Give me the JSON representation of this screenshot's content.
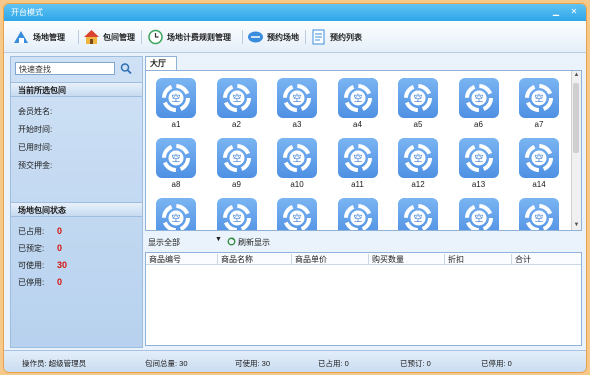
{
  "window": {
    "title": "开台模式"
  },
  "toolbar": {
    "items": [
      {
        "label": "场地管理"
      },
      {
        "label": "包间管理"
      },
      {
        "label": "场地计费规则管理"
      },
      {
        "label": "预约场地"
      },
      {
        "label": "预约列表"
      }
    ]
  },
  "sidebar": {
    "search_value": "快速查找",
    "current_title": "当前所选包间",
    "fields": [
      "会员姓名:",
      "开始时间:",
      "已用时间:",
      "预交押金:"
    ],
    "status_title": "场地包间状态",
    "stats": [
      {
        "label": "已占用:",
        "value": "0"
      },
      {
        "label": "已预定:",
        "value": "0"
      },
      {
        "label": "可使用:",
        "value": "30"
      },
      {
        "label": "已停用:",
        "value": "0"
      }
    ]
  },
  "main": {
    "tab": "大厅",
    "tile_glyph": "空",
    "tiles": [
      "a1",
      "a2",
      "a3",
      "a4",
      "a5",
      "a6",
      "a7",
      "a8",
      "a9",
      "a10",
      "a11",
      "a12",
      "a13",
      "a14",
      "",
      "",
      "",
      "",
      "",
      "",
      ""
    ],
    "filter": {
      "selected": "显示全部",
      "refresh": "刷新显示"
    },
    "table_headers": [
      "商品编号",
      "商品名称",
      "商品单价",
      "购买数量",
      "折扣",
      "合计"
    ]
  },
  "statusbar": [
    "操作员: 超级管理员",
    "包间总量: 30",
    "可使用: 30",
    "已占用: 0",
    "已预订: 0",
    "已停用: 0"
  ]
}
